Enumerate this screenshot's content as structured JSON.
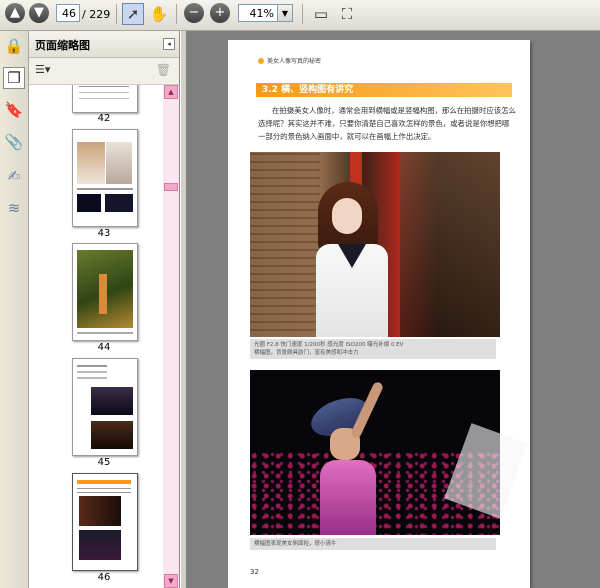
{
  "toolbar": {
    "current_page": "46",
    "total_pages": "/ 229",
    "zoom": "41%"
  },
  "panel": {
    "title": "页面缩略图",
    "options_icon": "☰▾",
    "thumbnails": [
      {
        "label": "42"
      },
      {
        "label": "43"
      },
      {
        "label": "44"
      },
      {
        "label": "45"
      },
      {
        "label": "46"
      }
    ]
  },
  "document": {
    "header_text": "美女人像写真的秘密",
    "section_title": "3.2  横、竖构图有讲究",
    "body": "在拍摄美女人像时，通常会用到横幅或是竖幅构图，那么在拍摄时应该怎么选择呢？其实这并不难，只要你清楚自己喜欢怎样的景色，或者说是你想把哪一部分的景色纳入画面中，就可以在画幅上作出决定。",
    "caption1_line1": "光圈 F2.8  快门速度 1/200秒  感光度 ISO200  曝光补偿 0 EV",
    "caption1_line2": "横幅图，背景颇具韵门，富有美感和冲击力",
    "caption2": "横幅图表现美女侧面睑，很小清牛",
    "page_number": "32"
  },
  "colors": {
    "section_bar": "#f59a12",
    "scrollbar": "#f4a8c8"
  }
}
